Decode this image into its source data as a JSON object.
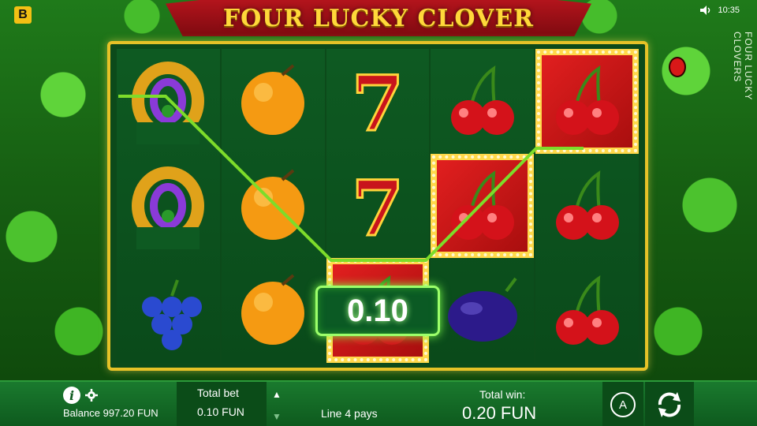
{
  "header": {
    "brand_letter": "B",
    "title": "FOUR LUCKY CLOVER",
    "clock": "10:35",
    "side_title": "FOUR LUCKY CLOVERS"
  },
  "reels": [
    [
      "horseshoe",
      "horseshoe",
      "grapes"
    ],
    [
      "orange",
      "orange",
      "orange"
    ],
    [
      "seven",
      "seven",
      "cherry"
    ],
    [
      "cherry",
      "cherry",
      "plum"
    ],
    [
      "cherry",
      "cherry",
      "cherry"
    ]
  ],
  "winning_cells": [
    [
      2,
      2
    ],
    [
      3,
      1
    ],
    [
      4,
      0
    ]
  ],
  "win_amount": "0.10",
  "bottom_bar": {
    "balance": "Balance 997.20 FUN",
    "total_bet_label": "Total bet",
    "total_bet_value": "0.10 FUN",
    "line_pays": "Line 4 pays",
    "total_win_label": "Total win:",
    "total_win_value": "0.20 FUN",
    "info_glyph": "i",
    "auto_glyph": "A"
  },
  "colors": {
    "accent_gold": "#e6c227",
    "payline_green": "#7ddc2a",
    "bar_green": "#1a7a2e"
  },
  "icons": [
    "speaker-icon",
    "info-icon",
    "gear-icon",
    "arrow-up-icon",
    "arrow-down-icon",
    "autoplay-icon",
    "spin-icon"
  ]
}
